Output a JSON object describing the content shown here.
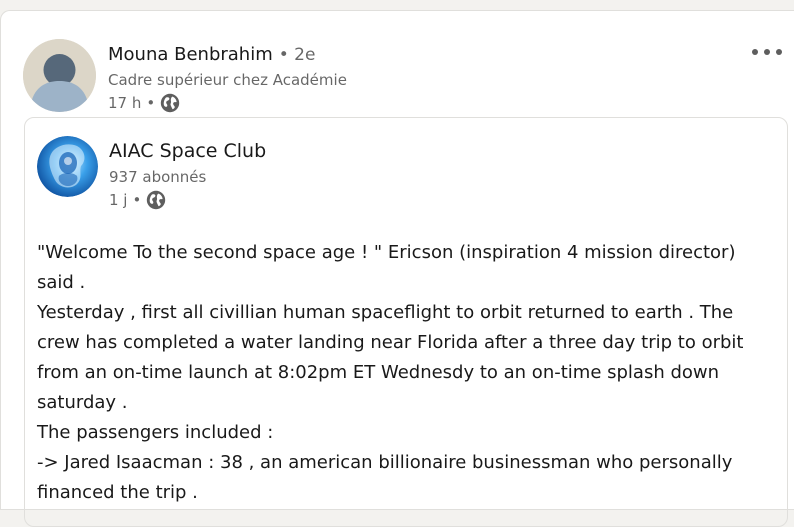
{
  "colors": {
    "page_bg": "#f3f2ef",
    "card_bg": "#ffffff",
    "text_primary": "rgba(0,0,0,0.9)",
    "text_secondary": "rgba(0,0,0,0.6)",
    "border": "#e0dfdc"
  },
  "post": {
    "author": {
      "name": "Mouna Benbrahim",
      "degree": "• 2e",
      "headline": "Cadre supérieur chez Académie",
      "time": "17 h",
      "meta_separator": "•",
      "avatar_icon": "default-avatar-icon",
      "visibility_icon": "globe-icon"
    },
    "menu_icon": "more-options-icon"
  },
  "shared_post": {
    "company": {
      "name": "AIAC Space Club",
      "followers": "937 abonnés",
      "time": "1 j",
      "meta_separator": "•",
      "logo_icon": "space-club-logo",
      "visibility_icon": "globe-icon"
    },
    "lines": [
      "\"Welcome To the second space age ! \" Ericson (inspiration 4 mission director)",
      "said .",
      "Yesterday , first all civillian human spaceflight to orbit returned to earth . The",
      "crew has completed a water landing near Florida after a three day trip to orbit",
      "from an on-time launch at 8:02pm ET Wednesdy to an on-time splash down",
      "saturday .",
      "The passengers included :",
      "-> Jared Isaacman : 38 , an american billionaire businessman who personally",
      "financed the trip ."
    ]
  }
}
